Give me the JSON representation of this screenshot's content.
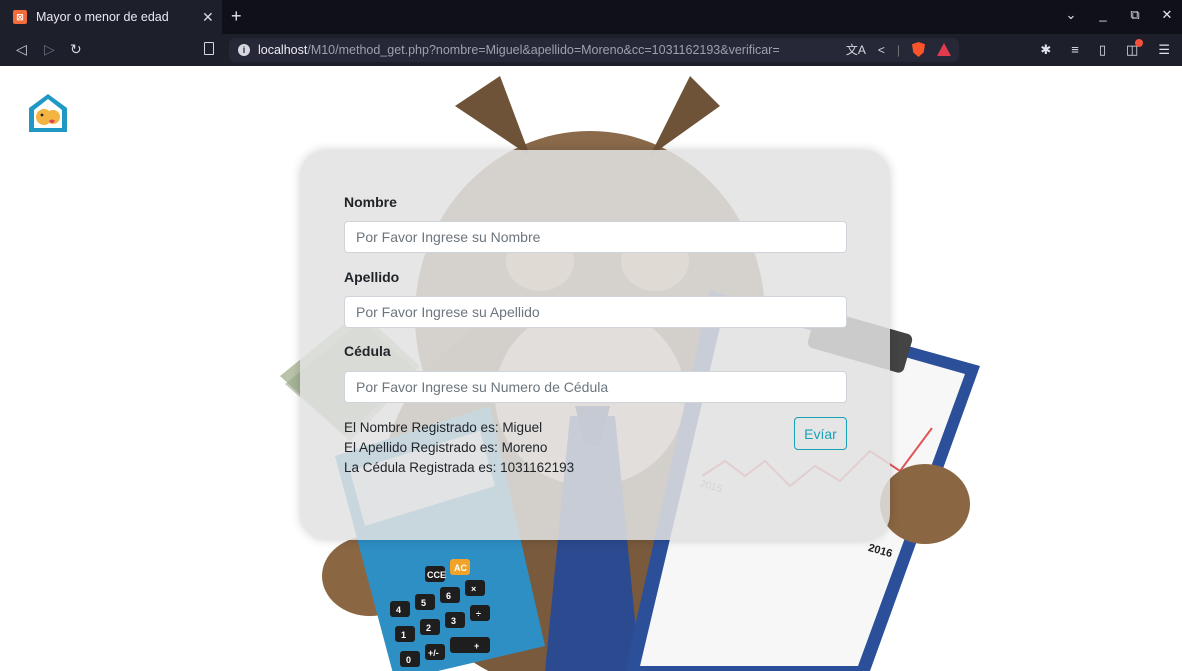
{
  "browser": {
    "tab_title": "Mayor o menor de edad",
    "url_host": "localhost",
    "url_path": "/M10/method_get.php?nombre=Miguel&apellido=Moreno&cc=1031162193&verificar="
  },
  "form": {
    "nombre_label": "Nombre",
    "nombre_placeholder": "Por Favor Ingrese su Nombre",
    "apellido_label": "Apellido",
    "apellido_placeholder": "Por Favor Ingrese su Apellido",
    "cedula_label": "Cédula",
    "cedula_placeholder": "Por Favor Ingrese su Numero de Cédula",
    "submit_label": "Evíar"
  },
  "results": {
    "nombre": "El Nombre Registrado es: Miguel",
    "apellido": "El Apellido Registrado es: Moreno",
    "cedula": "La Cédula Registrada es: 1031162193"
  },
  "illustration": {
    "year_left": "2015",
    "year_right": "2016",
    "calc_keys": [
      "CCE",
      "AC",
      "4",
      "5",
      "6",
      "×",
      "÷",
      "1",
      "2",
      "3",
      "+",
      "0",
      "+/-"
    ]
  },
  "colors": {
    "accent": "#17a2b8",
    "tab_bg": "#1d1f2b",
    "card_bg": "#e2e2e2"
  }
}
